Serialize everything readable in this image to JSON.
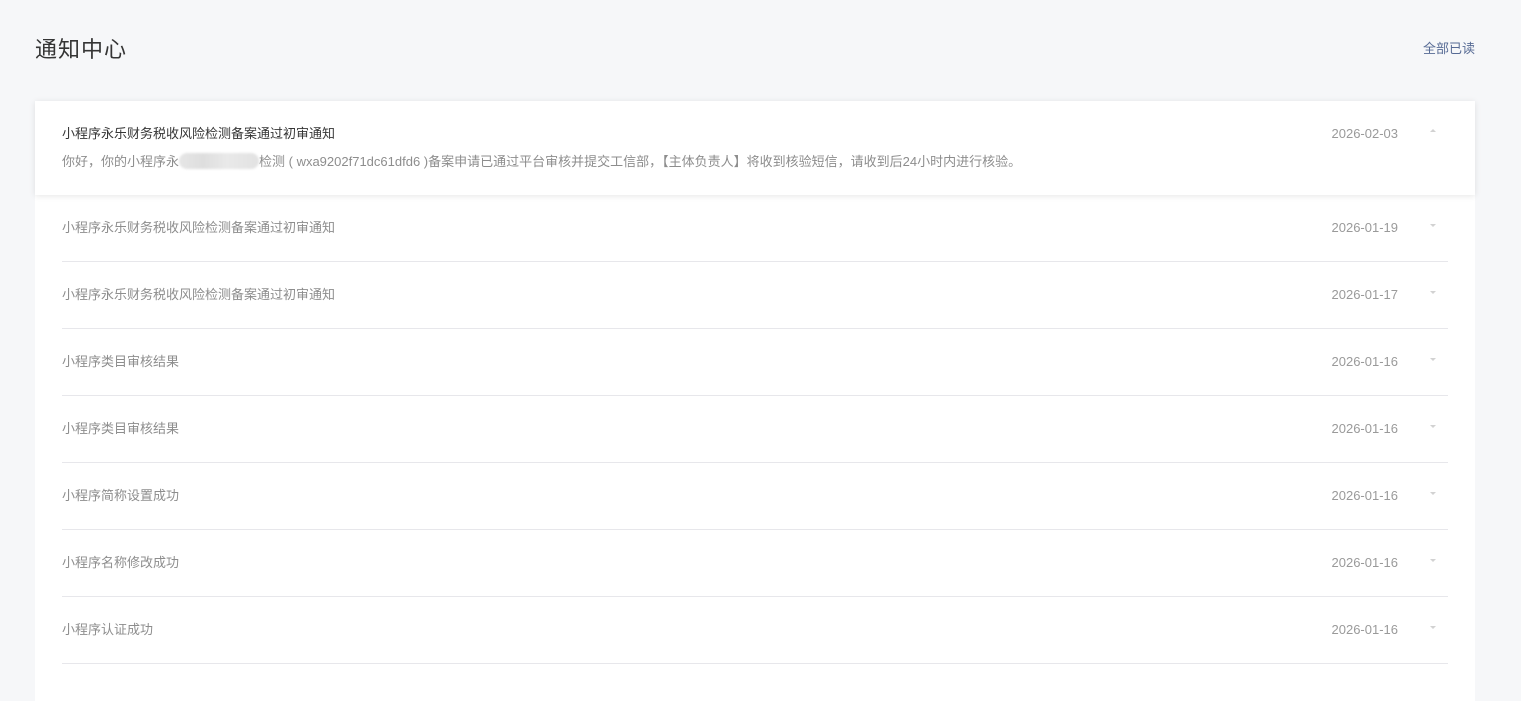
{
  "header": {
    "title": "通知中心",
    "mark_all_read": "全部已读"
  },
  "notifications": [
    {
      "title": "小程序永乐财务税收风险检测备案通过初审通知",
      "date": "2026-02-03",
      "expanded": true,
      "body_prefix": "你好，你的小程序永",
      "body_suffix": "检测 ( wxa9202f71dc61dfd6 )备案申请已通过平台审核并提交工信部，【主体负责人】将收到核验短信，请收到后24小时内进行核验。"
    },
    {
      "title": "小程序永乐财务税收风险检测备案通过初审通知",
      "date": "2026-01-19"
    },
    {
      "title": "小程序永乐财务税收风险检测备案通过初审通知",
      "date": "2026-01-17"
    },
    {
      "title": "小程序类目审核结果",
      "date": "2026-01-16"
    },
    {
      "title": "小程序类目审核结果",
      "date": "2026-01-16"
    },
    {
      "title": "小程序简称设置成功",
      "date": "2026-01-16"
    },
    {
      "title": "小程序名称修改成功",
      "date": "2026-01-16"
    },
    {
      "title": "小程序认证成功",
      "date": "2026-01-16"
    }
  ]
}
